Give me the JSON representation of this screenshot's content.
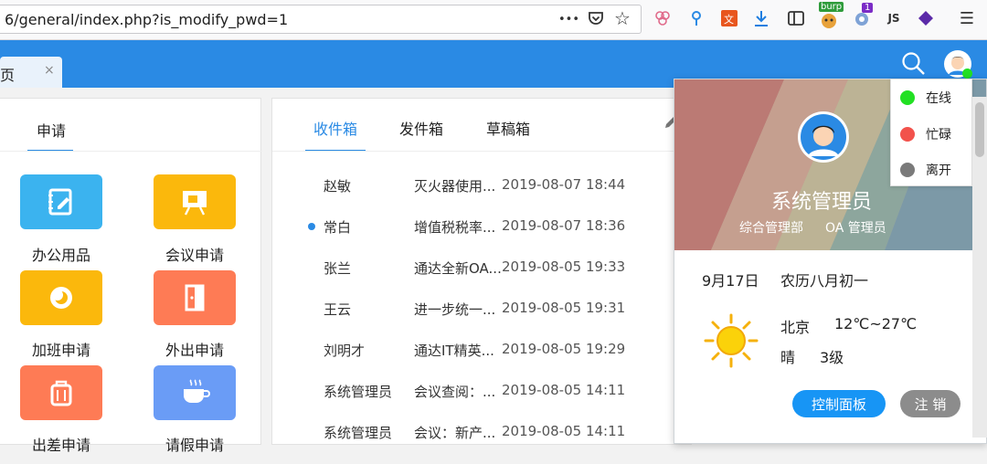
{
  "browser": {
    "url": "6/general/index.php?is_modify_pwd=1",
    "more_label": "•••",
    "ext_burp_badge": "burp",
    "ext_count_badge": "1",
    "ext_js_label": "JS",
    "menu_label": "☰"
  },
  "app_tabs": [
    {
      "label": "页",
      "close": "×"
    }
  ],
  "left_panel": {
    "tab_label": "申请",
    "apps": [
      {
        "label": "办公用品",
        "icon": "office-supplies-icon",
        "color": "#3bb3ef"
      },
      {
        "label": "会议申请",
        "icon": "meeting-board-icon",
        "color": "#fbb80c"
      },
      {
        "label": "加班申请",
        "icon": "overtime-moon-icon",
        "color": "#fbb80c"
      },
      {
        "label": "外出申请",
        "icon": "door-exit-icon",
        "color": "#fe7b55"
      },
      {
        "label": "出差申请",
        "icon": "luggage-icon",
        "color": "#fe7b55"
      },
      {
        "label": "请假申请",
        "icon": "coffee-cup-icon",
        "color": "#6a9cf6"
      }
    ]
  },
  "mail_panel": {
    "tabs": [
      {
        "label": "收件箱",
        "active": true
      },
      {
        "label": "发件箱",
        "active": false
      },
      {
        "label": "草稿箱",
        "active": false
      }
    ],
    "rows": [
      {
        "sender": "赵敏",
        "subject": "灭火器使用...",
        "time": "2019-08-07 18:44",
        "unread": false
      },
      {
        "sender": "常白",
        "subject": "增值税税率...",
        "time": "2019-08-07 18:36",
        "unread": true
      },
      {
        "sender": "张兰",
        "subject": "通达全新OA...",
        "time": "2019-08-05 19:33",
        "unread": false
      },
      {
        "sender": "王云",
        "subject": "进一步统一...",
        "time": "2019-08-05 19:31",
        "unread": false
      },
      {
        "sender": "刘明才",
        "subject": "通达IT精英...",
        "time": "2019-08-05 19:29",
        "unread": false
      },
      {
        "sender": "系统管理员",
        "subject": "会议查阅：...",
        "time": "2019-08-05 14:11",
        "unread": false
      },
      {
        "sender": "系统管理员",
        "subject": "会议：新产...",
        "time": "2019-08-05 14:11",
        "unread": false
      }
    ]
  },
  "user_panel": {
    "name": "系统管理员",
    "department": "综合管理部",
    "role": "OA 管理员",
    "date": "9月17日",
    "lunar_date": "农历八月初一",
    "city": "北京",
    "temperature": "12℃~27℃",
    "weather": "晴",
    "wind": "3级",
    "control_panel_label": "控制面板",
    "logout_label": "注 销",
    "accent_color": "#1795f5"
  },
  "status_menu": [
    {
      "label": "在线",
      "color": "#22e023"
    },
    {
      "label": "忙碌",
      "color": "#f2524c"
    },
    {
      "label": "离开",
      "color": "#7a7a7a"
    }
  ]
}
